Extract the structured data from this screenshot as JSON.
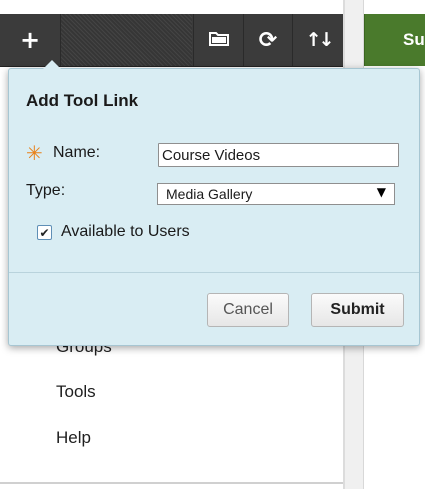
{
  "toolbar": {
    "add_icon": "+",
    "folder_icon": "folder-icon",
    "refresh_icon": "⟳",
    "sort_icon": "↑↓"
  },
  "right_strip": {
    "label": "Su"
  },
  "menu": {
    "items": [
      {
        "label": "Groups"
      },
      {
        "label": "Tools"
      },
      {
        "label": "Help"
      }
    ]
  },
  "popup": {
    "title": "Add Tool Link",
    "required_marker": "✳",
    "name_label": "Name:",
    "name_value": "Course Videos",
    "type_label": "Type:",
    "type_value": "Media Gallery",
    "type_caret": "▼",
    "checkbox_mark": "✔",
    "available_label": "Available to Users",
    "available_checked": true,
    "cancel_label": "Cancel",
    "submit_label": "Submit"
  },
  "colors": {
    "toolbar_bg": "#3b3b3b",
    "popup_bg": "#d9edf3",
    "submit_strip": "#4a7a2c",
    "required_star": "#e8821a"
  }
}
